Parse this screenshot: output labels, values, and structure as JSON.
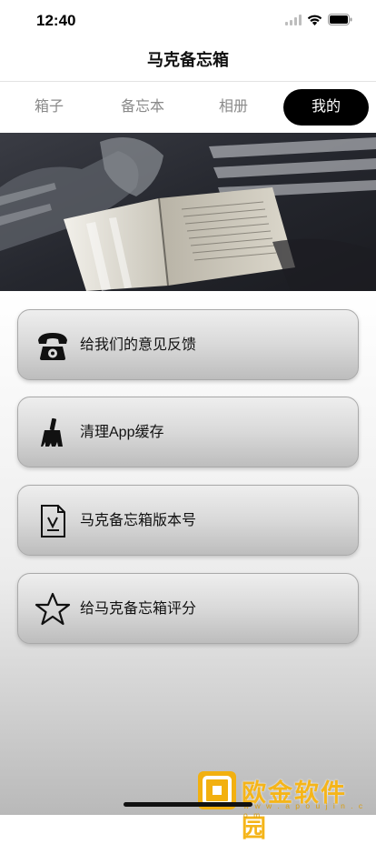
{
  "status": {
    "time": "12:40"
  },
  "nav": {
    "title": "马克备忘箱"
  },
  "tabs": [
    {
      "label": "箱子",
      "active": false
    },
    {
      "label": "备忘本",
      "active": false
    },
    {
      "label": "相册",
      "active": false
    },
    {
      "label": "我的",
      "active": true
    }
  ],
  "menu": [
    {
      "label": "给我们的意见反馈",
      "icon": "telephone-icon"
    },
    {
      "label": "清理App缓存",
      "icon": "broom-icon"
    },
    {
      "label": "马克备忘箱版本号",
      "icon": "document-download-icon"
    },
    {
      "label": "给马克备忘箱评分",
      "icon": "star-icon"
    }
  ],
  "watermark": {
    "text": "欧金软件园",
    "url": "w w w . a p o u j i n . c o m"
  },
  "colors": {
    "active_tab_bg": "#000000",
    "watermark": "#f5b51a"
  }
}
